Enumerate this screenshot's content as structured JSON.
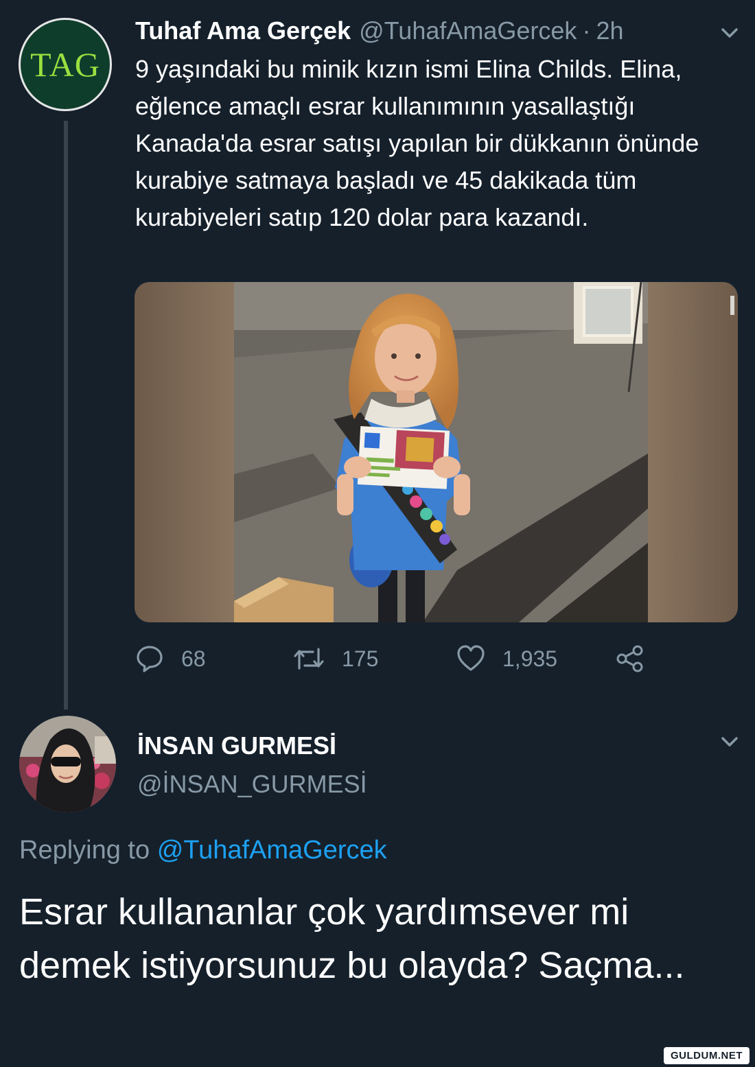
{
  "original_tweet": {
    "avatar_text": "TAG",
    "author_name": "Tuhaf Ama Gerçek",
    "author_handle": "@TuhafAmaGercek",
    "separator": "·",
    "time": "2h",
    "text": "9 yaşındaki bu minik kızın ismi Elina Childs. Elina, eğlence amaçlı esrar kullanımının yasallaştığı Kanada'da esrar satışı yapılan bir dükkanın önünde kurabiye satmaya başladı ve 45 dakikada tüm kurabiyeleri satıp 120 dolar para kazandı.",
    "photo_icon": "photo",
    "actions": {
      "reply_count": "68",
      "retweet_count": "175",
      "like_count": "1,935"
    },
    "icons": [
      "reply-icon",
      "retweet-icon",
      "like-icon",
      "share-icon",
      "chevron-down-icon"
    ]
  },
  "reply_tweet": {
    "author_name": "İNSAN GURMESİ",
    "author_handle": "@İNSAN_GURMESİ",
    "replying_prefix": "Replying to",
    "replying_mention": "@TuhafAmaGercek",
    "text": "Esrar kullananlar çok yardımsever mi demek istiyorsunuz bu olayda? Saçma..."
  },
  "watermark": "GULDUM.NET",
  "colors": {
    "background": "#15202b",
    "primary_text": "#ffffff",
    "secondary_text": "#8899a6",
    "link": "#1da1f2",
    "thread_line": "#38444d"
  }
}
